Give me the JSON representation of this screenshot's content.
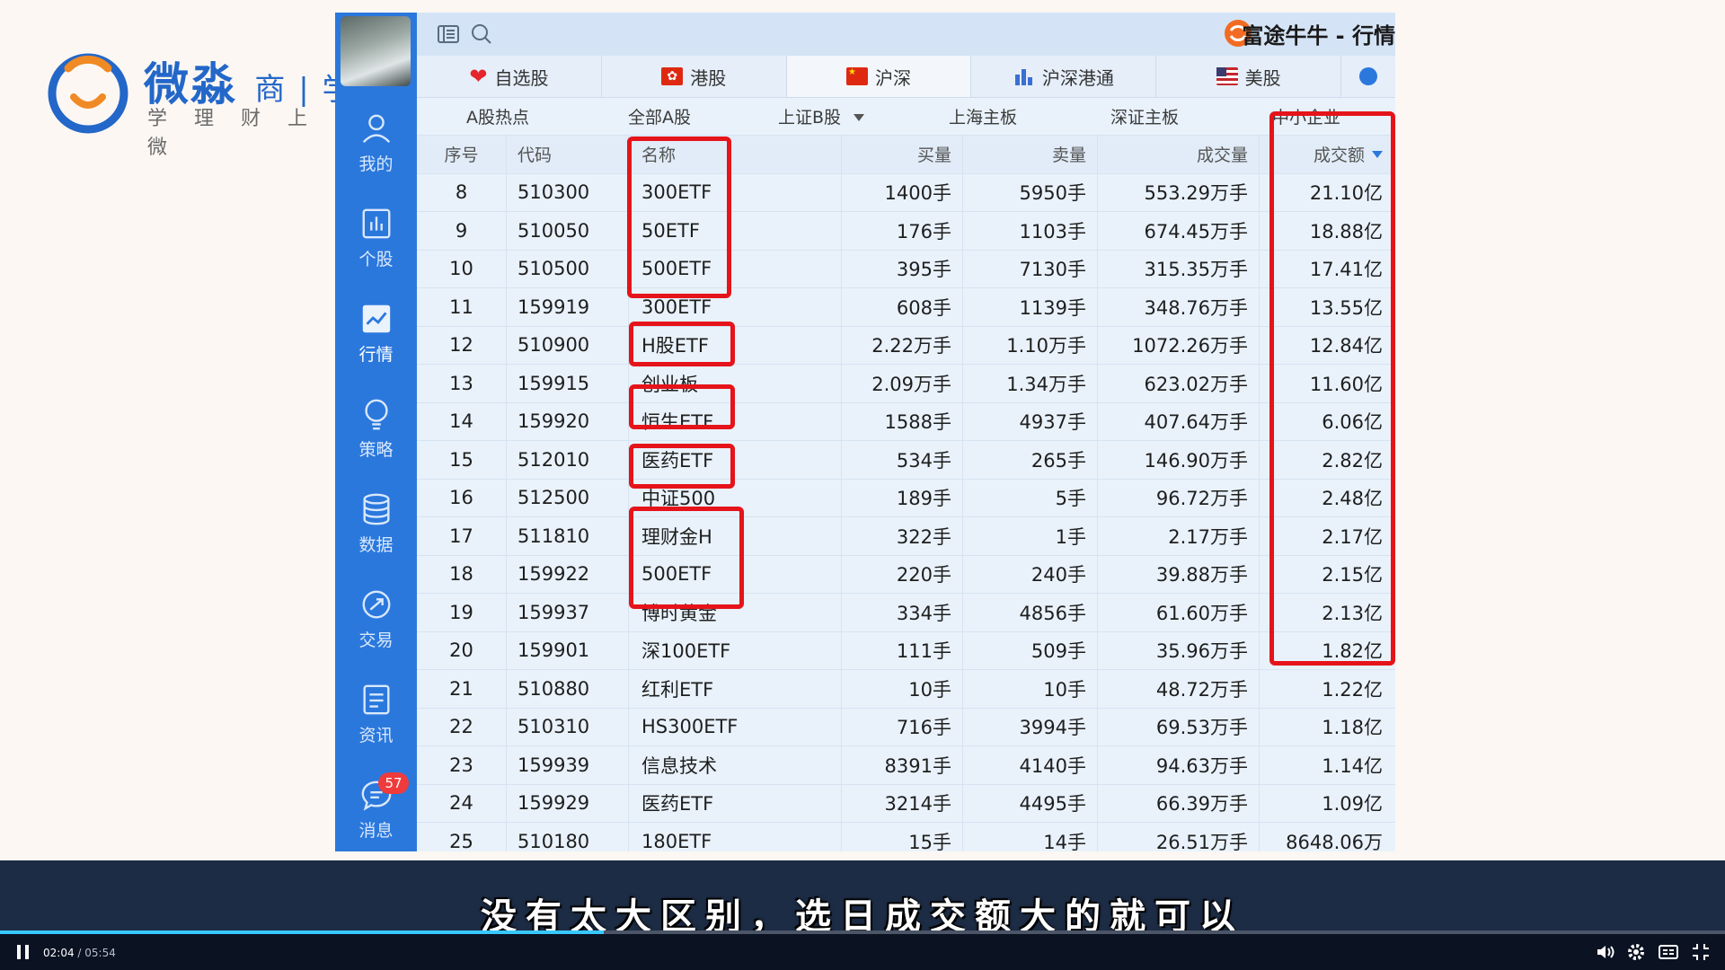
{
  "watermark": {
    "title": "微淼",
    "title_suffix": "商 | 学",
    "subtitle": "学理财上微"
  },
  "window": {
    "title": "富途牛牛 - 行情"
  },
  "sidebar": {
    "items": [
      {
        "label": "我的",
        "icon": "user-icon"
      },
      {
        "label": "个股",
        "icon": "bar-chart-icon"
      },
      {
        "label": "行情",
        "icon": "line-chart-icon",
        "active": true
      },
      {
        "label": "策略",
        "icon": "bulb-icon"
      },
      {
        "label": "数据",
        "icon": "database-icon"
      },
      {
        "label": "交易",
        "icon": "trade-icon"
      },
      {
        "label": "资讯",
        "icon": "news-icon"
      },
      {
        "label": "消息",
        "icon": "message-icon",
        "badge": "57"
      }
    ]
  },
  "market_tabs": [
    {
      "label": "自选股",
      "icon": "heart-icon"
    },
    {
      "label": "港股",
      "icon": "hk-flag-icon"
    },
    {
      "label": "沪深",
      "icon": "cn-flag-icon",
      "active": true
    },
    {
      "label": "沪深港通",
      "icon": "connect-icon"
    },
    {
      "label": "美股",
      "icon": "us-flag-icon"
    }
  ],
  "sub_tabs": [
    "A股热点",
    "全部A股",
    "上证B股",
    "上海主板",
    "深证主板",
    "中小企业"
  ],
  "table": {
    "headers": {
      "idx": "序号",
      "code": "代码",
      "name": "名称",
      "buy": "买量",
      "sell": "卖量",
      "volume": "成交量",
      "amount": "成交额"
    },
    "rows": [
      {
        "idx": "8",
        "code": "510300",
        "name": "300ETF",
        "buy": "1400手",
        "sell": "5950手",
        "volume": "553.29万手",
        "amount": "21.10亿"
      },
      {
        "idx": "9",
        "code": "510050",
        "name": "50ETF",
        "buy": "176手",
        "sell": "1103手",
        "volume": "674.45万手",
        "amount": "18.88亿"
      },
      {
        "idx": "10",
        "code": "510500",
        "name": "500ETF",
        "buy": "395手",
        "sell": "7130手",
        "volume": "315.35万手",
        "amount": "17.41亿"
      },
      {
        "idx": "11",
        "code": "159919",
        "name": "300ETF",
        "buy": "608手",
        "sell": "1139手",
        "volume": "348.76万手",
        "amount": "13.55亿"
      },
      {
        "idx": "12",
        "code": "510900",
        "name": "H股ETF",
        "buy": "2.22万手",
        "sell": "1.10万手",
        "volume": "1072.26万手",
        "amount": "12.84亿"
      },
      {
        "idx": "13",
        "code": "159915",
        "name": "创业板",
        "buy": "2.09万手",
        "sell": "1.34万手",
        "volume": "623.02万手",
        "amount": "11.60亿"
      },
      {
        "idx": "14",
        "code": "159920",
        "name": "恒生ETF",
        "buy": "1588手",
        "sell": "4937手",
        "volume": "407.64万手",
        "amount": "6.06亿"
      },
      {
        "idx": "15",
        "code": "512010",
        "name": "医药ETF",
        "buy": "534手",
        "sell": "265手",
        "volume": "146.90万手",
        "amount": "2.82亿"
      },
      {
        "idx": "16",
        "code": "512500",
        "name": "中证500",
        "buy": "189手",
        "sell": "5手",
        "volume": "96.72万手",
        "amount": "2.48亿"
      },
      {
        "idx": "17",
        "code": "511810",
        "name": "理财金H",
        "buy": "322手",
        "sell": "1手",
        "volume": "2.17万手",
        "amount": "2.17亿"
      },
      {
        "idx": "18",
        "code": "159922",
        "name": "500ETF",
        "buy": "220手",
        "sell": "240手",
        "volume": "39.88万手",
        "amount": "2.15亿"
      },
      {
        "idx": "19",
        "code": "159937",
        "name": "博时黄金",
        "buy": "334手",
        "sell": "4856手",
        "volume": "61.60万手",
        "amount": "2.13亿"
      },
      {
        "idx": "20",
        "code": "159901",
        "name": "深100ETF",
        "buy": "111手",
        "sell": "509手",
        "volume": "35.96万手",
        "amount": "1.82亿"
      },
      {
        "idx": "21",
        "code": "510880",
        "name": "红利ETF",
        "buy": "10手",
        "sell": "10手",
        "volume": "48.72万手",
        "amount": "1.22亿"
      },
      {
        "idx": "22",
        "code": "510310",
        "name": "HS300ETF",
        "buy": "716手",
        "sell": "3994手",
        "volume": "69.53万手",
        "amount": "1.18亿"
      },
      {
        "idx": "23",
        "code": "159939",
        "name": "信息技术",
        "buy": "8391手",
        "sell": "4140手",
        "volume": "94.63万手",
        "amount": "1.14亿"
      },
      {
        "idx": "24",
        "code": "159929",
        "name": "医药ETF",
        "buy": "3214手",
        "sell": "4495手",
        "volume": "66.39万手",
        "amount": "1.09亿"
      },
      {
        "idx": "25",
        "code": "510180",
        "name": "180ETF",
        "buy": "15手",
        "sell": "14手",
        "volume": "26.51万手",
        "amount": "8648.06万"
      }
    ]
  },
  "video": {
    "subtitle": "没有太大区别，选日成交额大的就可以",
    "current_time": "02:04",
    "duration": "05:54",
    "progress": 0.35
  }
}
